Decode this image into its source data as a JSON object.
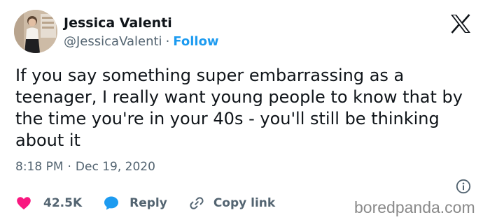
{
  "author": {
    "name": "Jessica Valenti",
    "handle": "@JessicaValenti",
    "separator": "·",
    "follow_label": "Follow"
  },
  "tweet": {
    "text": "If you say something super embarrassing as a teenager, I really want young people to know that by the time you're in your 40s - you'll still be thinking about it",
    "time": "8:18 PM",
    "separator": "·",
    "date": "Dec 19, 2020"
  },
  "actions": {
    "likes_count": "42.5K",
    "reply_label": "Reply",
    "copy_link_label": "Copy link"
  },
  "watermark": "boredpanda.com",
  "colors": {
    "text": "#0f1419",
    "secondary": "#536471",
    "follow": "#1d9bf0",
    "like": "#f91880",
    "reply": "#1d9bf0"
  },
  "icons": {
    "platform": "x-logo-icon",
    "like": "heart-icon",
    "reply": "speech-bubble-icon",
    "copy": "link-icon",
    "info": "info-icon"
  }
}
